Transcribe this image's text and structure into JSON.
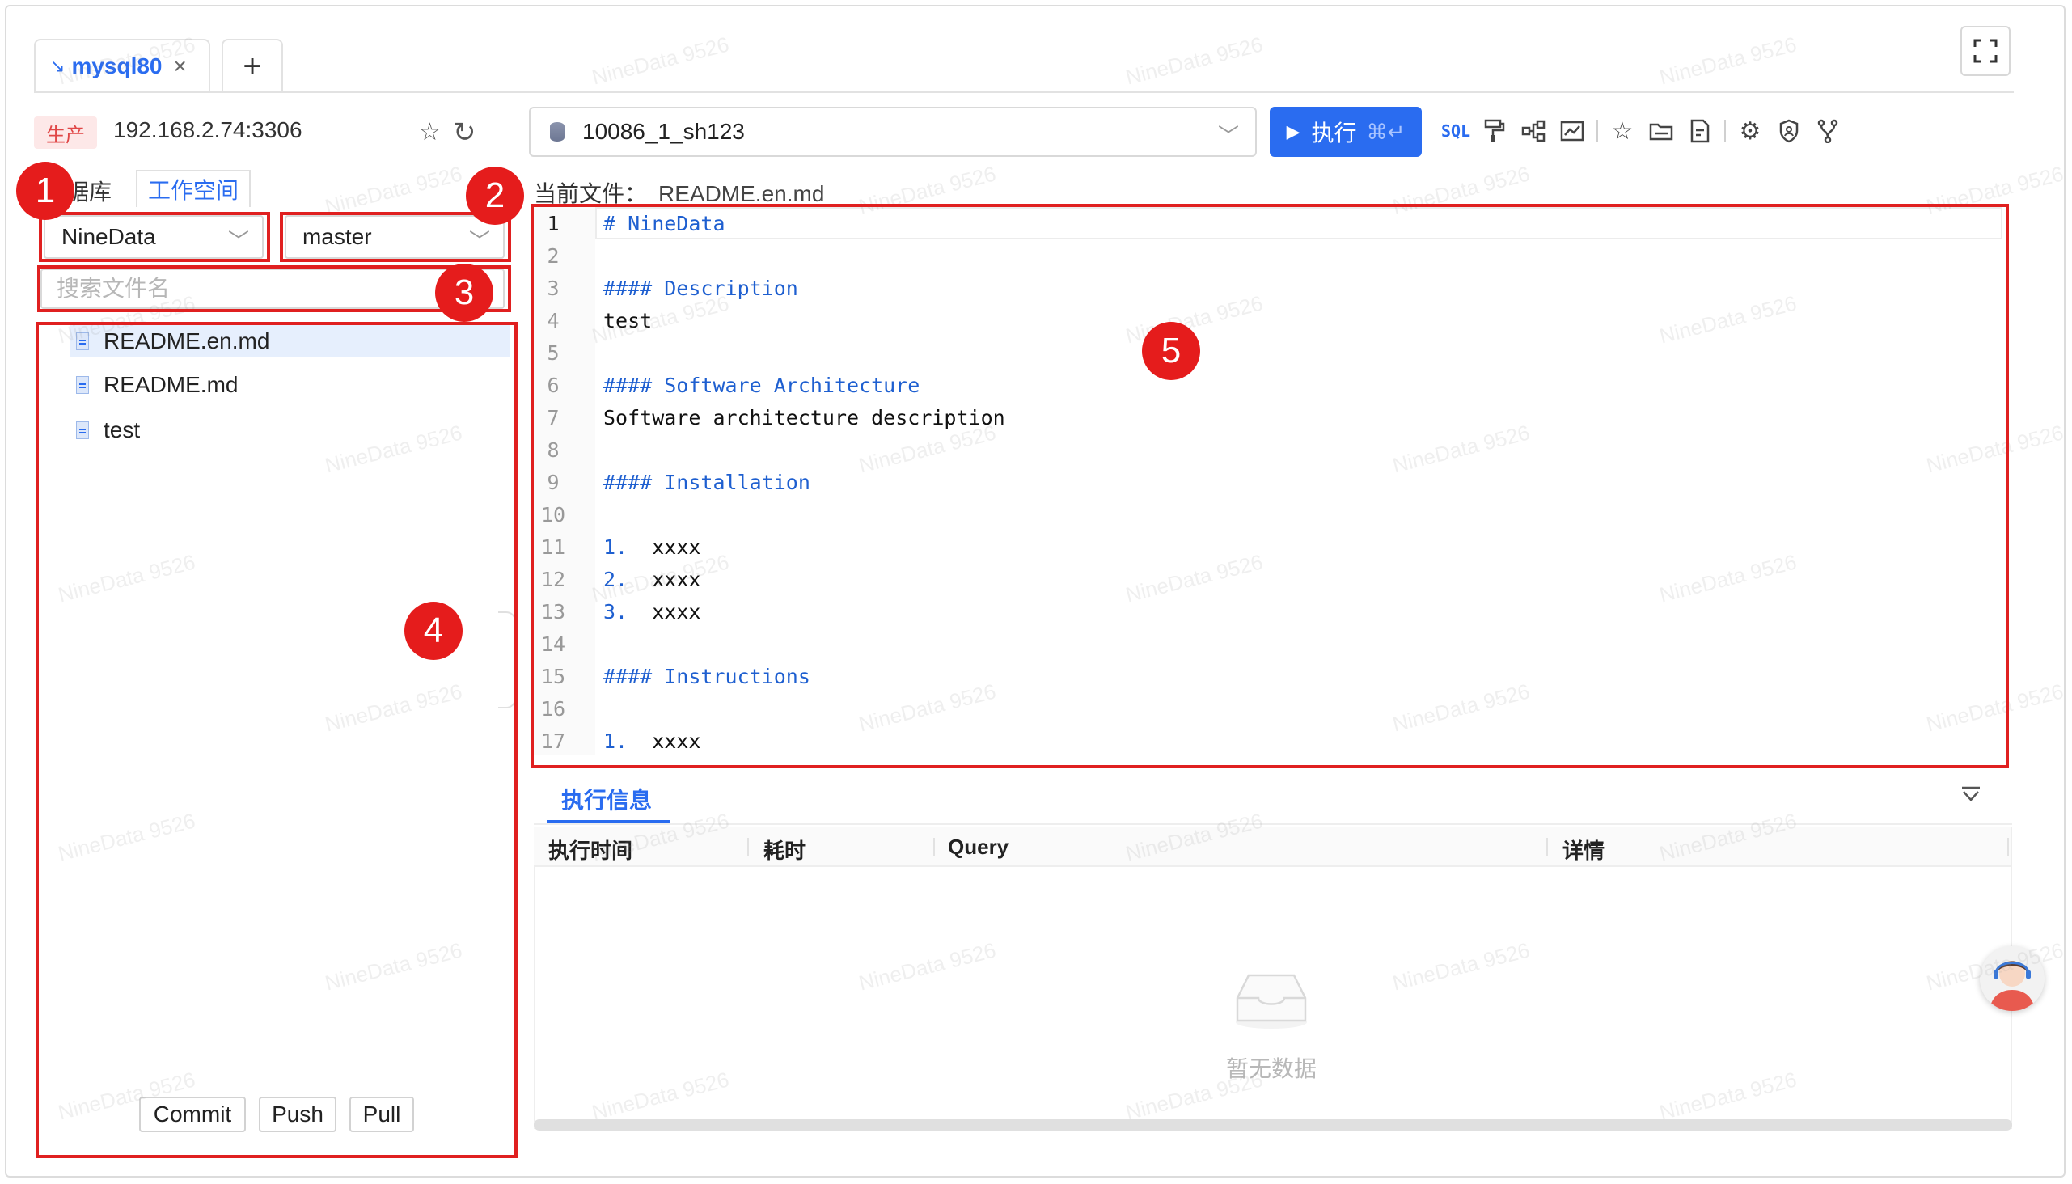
{
  "tabs": [
    {
      "label": "mysql80",
      "active": true
    }
  ],
  "tab_add_label": "+",
  "connection": {
    "env_badge": "生产",
    "address": "192.168.2.74:3306",
    "database": "10086_1_sh123"
  },
  "run_button": {
    "label": "执行",
    "shortcut": "⌘↵"
  },
  "toolbar_icons": [
    "sql-format-icon",
    "paint-brush-icon",
    "schema-icon",
    "chart-icon",
    "star-icon",
    "folder-icon",
    "file-icon",
    "gear-icon",
    "shield-icon",
    "branch-icon"
  ],
  "toolbar_sql_text": "SQL",
  "left_panel": {
    "tab_database": "据库",
    "tab_workspace": "工作空间",
    "repo": "NineData",
    "branch": "master",
    "search_placeholder": "搜索文件名",
    "files": [
      "README.en.md",
      "README.md",
      "test"
    ],
    "buttons": {
      "commit": "Commit",
      "push": "Push",
      "pull": "Pull"
    }
  },
  "editor": {
    "current_file_label": "当前文件：",
    "current_file": "README.en.md",
    "lines": [
      {
        "n": "1",
        "text": "# NineData",
        "h": true
      },
      {
        "n": "2",
        "text": "",
        "h": false
      },
      {
        "n": "3",
        "text": "#### Description",
        "h": true
      },
      {
        "n": "4",
        "text": "test",
        "h": false
      },
      {
        "n": "5",
        "text": "",
        "h": false
      },
      {
        "n": "6",
        "text": "#### Software Architecture",
        "h": true
      },
      {
        "n": "7",
        "text": "Software architecture description",
        "h": false
      },
      {
        "n": "8",
        "text": "",
        "h": false
      },
      {
        "n": "9",
        "text": "#### Installation",
        "h": true
      },
      {
        "n": "10",
        "text": "",
        "h": false
      },
      {
        "n": "11",
        "text": "1.  xxxx",
        "h": false
      },
      {
        "n": "12",
        "text": "2.  xxxx",
        "h": false
      },
      {
        "n": "13",
        "text": "3.  xxxx",
        "h": false
      },
      {
        "n": "14",
        "text": "",
        "h": false
      },
      {
        "n": "15",
        "text": "#### Instructions",
        "h": true
      },
      {
        "n": "16",
        "text": "",
        "h": false
      },
      {
        "n": "17",
        "text": "1.  xxxx",
        "h": false
      }
    ]
  },
  "bottom_panel": {
    "tab": "执行信息",
    "columns": [
      "执行时间",
      "耗时",
      "Query",
      "详情"
    ],
    "empty_text": "暂无数据"
  },
  "watermark": "NineData 9526",
  "annotations": [
    "1",
    "2",
    "3",
    "4",
    "5"
  ],
  "colors": {
    "accent": "#2a6cf0",
    "annotation": "#e02020",
    "env_badge_bg": "#fde8e8",
    "env_badge_text": "#e04646"
  }
}
